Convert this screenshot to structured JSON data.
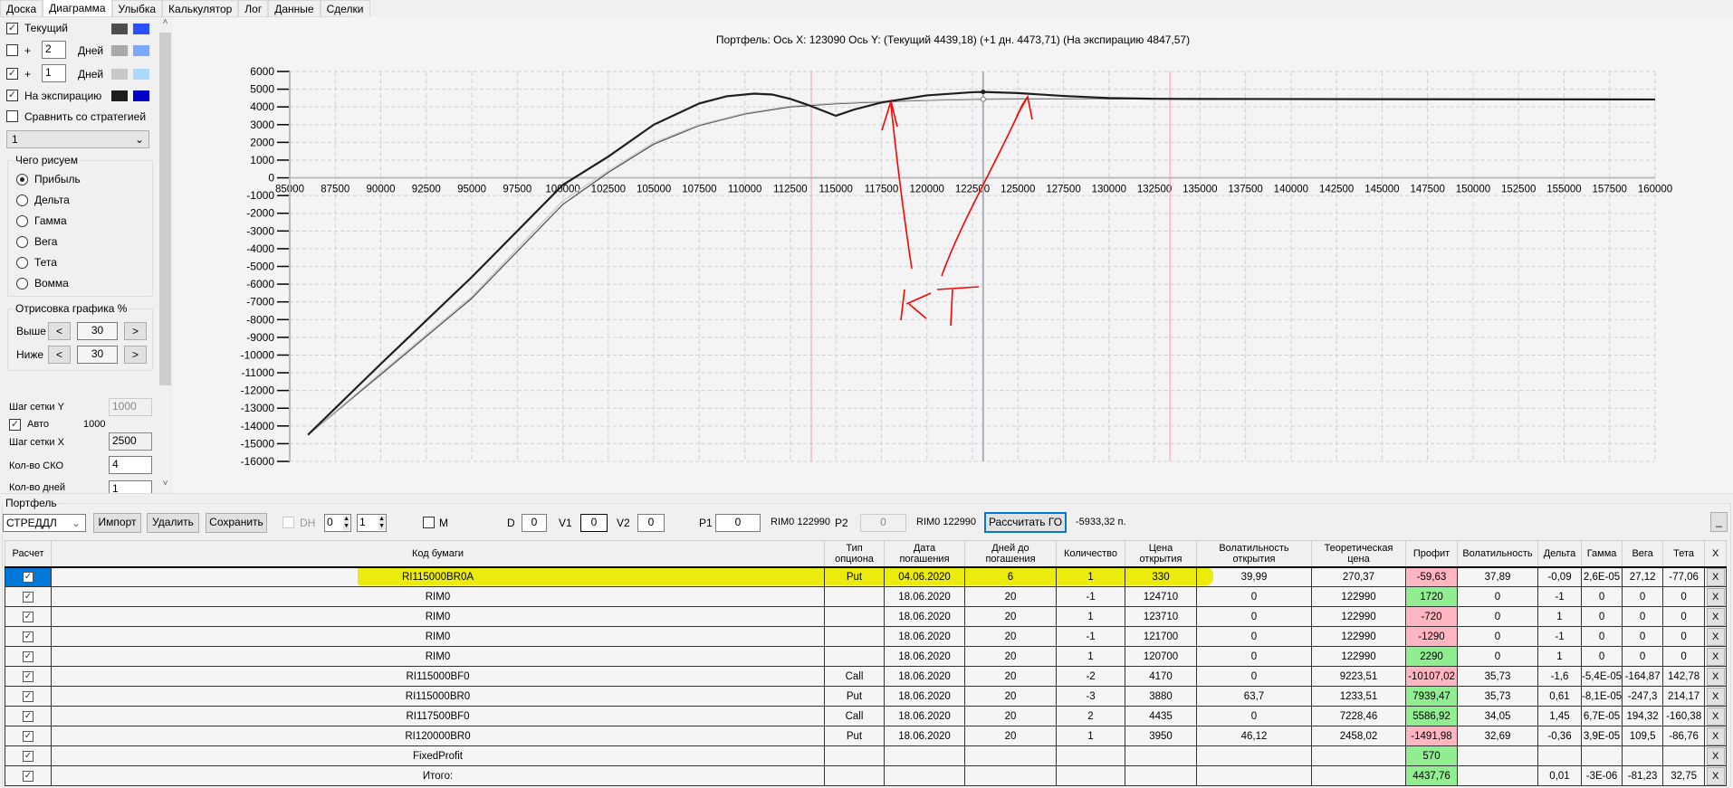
{
  "tabs": [
    "Доска",
    "Диаграмма",
    "Улыбка",
    "Калькулятор",
    "Лог",
    "Данные",
    "Сделки"
  ],
  "left": {
    "current_label": "Текущий",
    "current_checked": true,
    "current_colors": [
      "#4d4d4d",
      "#2b50ff"
    ],
    "plus_label": "+",
    "days_label": "Дней",
    "plus2_value": "2",
    "plus2_checked": false,
    "plus2_colors": [
      "#a8a8a8",
      "#7ba7ff"
    ],
    "plus1_value": "1",
    "plus1_checked": true,
    "plus1_colors": [
      "#c8c8c8",
      "#aad8ff"
    ],
    "exp_label": "На экспирацию",
    "exp_checked": true,
    "exp_colors": [
      "#1e1e1e",
      "#0000c8"
    ],
    "compare_label": "Сравнить со стратегией",
    "compare_checked": false,
    "strategy_select": "1",
    "draw_group": "Чего рисуем",
    "radios": [
      "Прибыль",
      "Дельта",
      "Гамма",
      "Вега",
      "Тета",
      "Вомма"
    ],
    "radio_selected": 0,
    "render_group": "Отрисовка графика %",
    "above_label": "Выше",
    "above_value": "30",
    "below_label": "Ниже",
    "below_value": "30",
    "prev": "<",
    "next": ">",
    "grid_y_label": "Шаг сетки Y",
    "grid_y_value": "1000",
    "auto_label": "Авто",
    "auto_value": "1000",
    "grid_x_label": "Шаг сетки X",
    "grid_x_value": "2500",
    "sko_label": "Кол-во СКО",
    "sko_value": "4",
    "days_count_label": "Кол-во дней",
    "days_count_value": "1"
  },
  "chart_data": {
    "type": "line",
    "title": "Портфель: Ось X: 123090 Ось Y:  (Текущий 4439,18)  (+1 дн. 4473,71)  (На экспирацию 4847,57)",
    "xlim": [
      85000,
      160000
    ],
    "ylim": [
      -16000,
      6000
    ],
    "xticks": [
      85000,
      87500,
      90000,
      92500,
      95000,
      97500,
      100000,
      102500,
      105000,
      107500,
      110000,
      112500,
      115000,
      117500,
      120000,
      122500,
      125000,
      127500,
      130000,
      132500,
      135000,
      137500,
      140000,
      142500,
      145000,
      147500,
      150000,
      152500,
      155000,
      157500,
      160000
    ],
    "yticks": [
      6000,
      5000,
      4000,
      3000,
      2000,
      1000,
      0,
      -1000,
      -2000,
      -3000,
      -4000,
      -5000,
      -6000,
      -7000,
      -8000,
      -9000,
      -10000,
      -11000,
      -12000,
      -13000,
      -14000,
      -15000,
      -16000
    ],
    "grid": true,
    "cursor_x": 123090,
    "red_lines": [
      113650,
      133350
    ],
    "series": [
      {
        "name": "На экспирацию",
        "color": "#1e1e1e",
        "x": [
          86000,
          90000,
          95000,
          100000,
          102500,
          105000,
          107500,
          109000,
          110500,
          111500,
          112500,
          113500,
          115000,
          116000,
          117500,
          120000,
          122500,
          123090,
          125000,
          127500,
          130000,
          132500,
          135000,
          160000
        ],
        "y": [
          -14500,
          -10500,
          -5600,
          -400,
          1200,
          3000,
          4200,
          4600,
          4750,
          4700,
          4450,
          4100,
          3500,
          3850,
          4250,
          4650,
          4830,
          4847,
          4780,
          4620,
          4500,
          4460,
          4450,
          4420
        ]
      },
      {
        "name": "+1 дн.",
        "color": "#c8c8c8",
        "x": [
          86000,
          90000,
          95000,
          100000,
          102500,
          105000,
          107500,
          110000,
          112500,
          115000,
          117500,
          120000,
          122500,
          125000,
          130000,
          135000,
          160000
        ],
        "y": [
          -14500,
          -11000,
          -6700,
          -1300,
          400,
          2000,
          3000,
          3650,
          4050,
          4220,
          4320,
          4400,
          4460,
          4480,
          4470,
          4450,
          4420
        ]
      },
      {
        "name": "Текущий",
        "color": "#4d4d4d",
        "x": [
          86000,
          90000,
          95000,
          100000,
          102500,
          105000,
          107500,
          110000,
          112500,
          115000,
          117500,
          120000,
          122500,
          125000,
          130000,
          135000,
          160000
        ],
        "y": [
          -14500,
          -11100,
          -6800,
          -1500,
          300,
          1900,
          2950,
          3600,
          4000,
          4180,
          4290,
          4370,
          4430,
          4450,
          4450,
          4440,
          4420
        ]
      }
    ]
  },
  "portfolio": {
    "group_label": "Портфель",
    "strategy": "СТРЕДДЛ",
    "import": "Импорт",
    "delete": "Удалить",
    "save": "Сохранить",
    "dh_label": "DH",
    "spin1": "0",
    "spin2": "1",
    "m_label": "M",
    "d_label": "D",
    "d_value": "0",
    "v1_label": "V1",
    "v1_value": "0",
    "v2_label": "V2",
    "v2_value": "0",
    "p1_label": "P1",
    "p1_value": "0",
    "p1_ref": "RIM0 122990",
    "p2_label": "P2",
    "p2_value": "0",
    "p2_ref": "RIM0 122990",
    "calc_go": "Рассчитать ГО",
    "go_value": "-5933,32 п.",
    "minimize": "_"
  },
  "table": {
    "columns": [
      "Расчет",
      "Код бумаги",
      "Тип\nопциона",
      "Дата\nпогашения",
      "Дней до\nпогашения",
      "Количество",
      "Цена\nоткрытия",
      "Волатильность\nоткрытия",
      "Теоретическая\nцена",
      "Профит",
      "Волатильность",
      "Дельта",
      "Гамма",
      "Вега",
      "Тета",
      "X"
    ],
    "rows": [
      [
        "✓",
        "RI115000BR0A",
        "Put",
        "04.06.2020",
        "6",
        "1",
        "330",
        "39,99",
        "270,37",
        "-59,63",
        "37,89",
        "-0,09",
        "2,6E-05",
        "27,12",
        "-77,06",
        "X"
      ],
      [
        "✓",
        "RIM0",
        "",
        "18.06.2020",
        "20",
        "-1",
        "124710",
        "0",
        "122990",
        "1720",
        "0",
        "-1",
        "0",
        "0",
        "0",
        "X"
      ],
      [
        "✓",
        "RIM0",
        "",
        "18.06.2020",
        "20",
        "1",
        "123710",
        "0",
        "122990",
        "-720",
        "0",
        "1",
        "0",
        "0",
        "0",
        "X"
      ],
      [
        "✓",
        "RIM0",
        "",
        "18.06.2020",
        "20",
        "-1",
        "121700",
        "0",
        "122990",
        "-1290",
        "0",
        "-1",
        "0",
        "0",
        "0",
        "X"
      ],
      [
        "✓",
        "RIM0",
        "",
        "18.06.2020",
        "20",
        "1",
        "120700",
        "0",
        "122990",
        "2290",
        "0",
        "1",
        "0",
        "0",
        "0",
        "X"
      ],
      [
        "✓",
        "RI115000BF0",
        "Call",
        "18.06.2020",
        "20",
        "-2",
        "4170",
        "0",
        "9223,51",
        "-10107,02",
        "35,73",
        "-1,6",
        "-5,4E-05",
        "-164,87",
        "142,78",
        "X"
      ],
      [
        "✓",
        "RI115000BR0",
        "Put",
        "18.06.2020",
        "20",
        "-3",
        "3880",
        "63,7",
        "1233,51",
        "7939,47",
        "35,73",
        "0,61",
        "-8,1E-05",
        "-247,3",
        "214,17",
        "X"
      ],
      [
        "✓",
        "RI117500BF0",
        "Call",
        "18.06.2020",
        "20",
        "2",
        "4435",
        "0",
        "7228,46",
        "5586,92",
        "34,05",
        "1,45",
        "6,7E-05",
        "194,32",
        "-160,38",
        "X"
      ],
      [
        "✓",
        "RI120000BR0",
        "Put",
        "18.06.2020",
        "20",
        "1",
        "3950",
        "46,12",
        "2458,02",
        "-1491,98",
        "32,69",
        "-0,36",
        "3,9E-05",
        "109,5",
        "-86,76",
        "X"
      ],
      [
        "✓",
        "FixedProfit",
        "",
        "",
        "",
        "",
        "",
        "",
        "",
        "570",
        "",
        "",
        "",
        "",
        "",
        "X"
      ],
      [
        "✓",
        "Итого:",
        "",
        "",
        "",
        "",
        "",
        "",
        "",
        "4437,76",
        "",
        "0,01",
        "-3E-06",
        "-81,23",
        "32,75",
        "X"
      ]
    ],
    "profit_colors": {
      "negative": "#ffb6c1",
      "positive": "#90ee90"
    },
    "selected_row": 0,
    "highlight_color": "#f5f500"
  }
}
